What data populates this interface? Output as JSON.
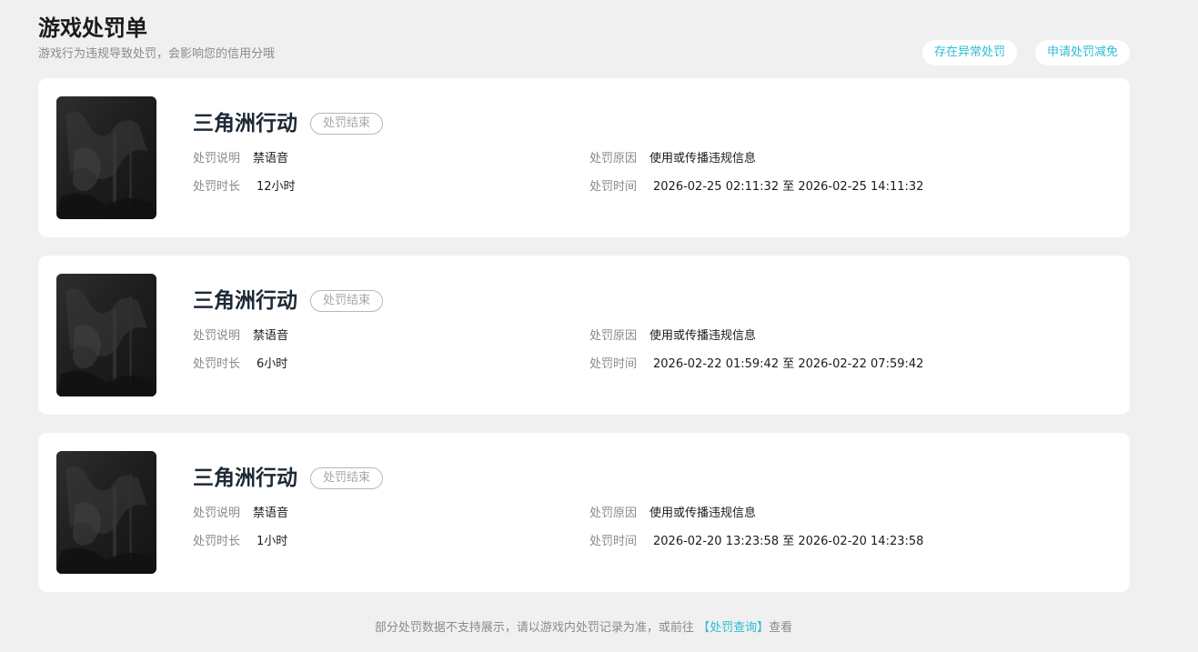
{
  "header": {
    "title": "游戏处罚单",
    "subtitle": "游戏行为违规导致处罚，会影响您的信用分哦"
  },
  "actions": {
    "abnormal_label": "存在异常处罚",
    "appeal_label": "申请处罚减免"
  },
  "labels": {
    "desc": "处罚说明",
    "duration": "处罚时长",
    "reason": "处罚原因",
    "time": "处罚时间"
  },
  "records": [
    {
      "game": "三角洲行动",
      "status": "处罚结束",
      "desc": "禁语音",
      "duration": "12小时",
      "reason": "使用或传播违规信息",
      "time": "2026-02-25 02:11:32 至 2026-02-25 14:11:32"
    },
    {
      "game": "三角洲行动",
      "status": "处罚结束",
      "desc": "禁语音",
      "duration": "6小时",
      "reason": "使用或传播违规信息",
      "time": "2026-02-22 01:59:42 至 2026-02-22 07:59:42"
    },
    {
      "game": "三角洲行动",
      "status": "处罚结束",
      "desc": "禁语音",
      "duration": "1小时",
      "reason": "使用或传播违规信息",
      "time": "2026-02-20 13:23:58 至 2026-02-20 14:23:58"
    }
  ],
  "footer": {
    "text_before": "部分处罚数据不支持展示，请以游戏内处罚记录为准，或前往",
    "link": "【处罚查询】",
    "text_after": "查看"
  },
  "colors": {
    "accent": "#2ebcd6",
    "background": "#f0f0f0",
    "card": "#ffffff"
  }
}
